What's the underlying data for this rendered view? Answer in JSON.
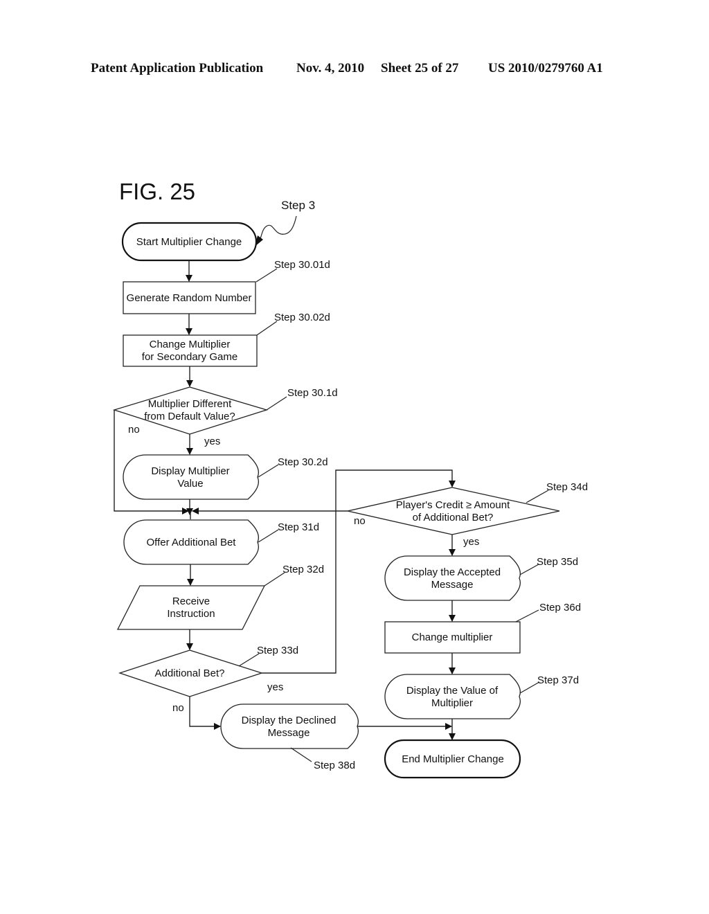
{
  "header": {
    "publication": "Patent Application Publication",
    "date": "Nov. 4, 2010",
    "sheet": "Sheet 25 of 27",
    "patent_number": "US 2010/0279760 A1"
  },
  "figure": {
    "title": "FIG. 25",
    "entry_label": "Step 3"
  },
  "nodes": {
    "start": {
      "type": "terminal",
      "lines": [
        "Start Multiplier Change"
      ]
    },
    "generate": {
      "type": "process",
      "step": "Step 30.01d",
      "lines": [
        "Generate Random Number"
      ]
    },
    "change_secondary": {
      "type": "process",
      "step": "Step 30.02d",
      "lines": [
        "Change Multiplier",
        "for Secondary Game"
      ]
    },
    "decision_default": {
      "type": "decision",
      "step": "Step 30.1d",
      "lines": [
        "Multiplier Different",
        "from Default Value?"
      ]
    },
    "display_value": {
      "type": "display",
      "step": "Step 30.2d",
      "lines": [
        "Display Multiplier",
        "Value"
      ]
    },
    "offer_bet": {
      "type": "display",
      "step": "Step 31d",
      "lines": [
        "Offer Additional Bet"
      ]
    },
    "receive": {
      "type": "input",
      "step": "Step 32d",
      "lines": [
        "Receive",
        "Instruction"
      ]
    },
    "decision_bet": {
      "type": "decision",
      "step": "Step 33d",
      "lines": [
        "Additional Bet?"
      ]
    },
    "decision_credit": {
      "type": "decision",
      "step": "Step 34d",
      "lines": [
        "Player's Credit ≥ Amount",
        "of Additional Bet?"
      ]
    },
    "display_accepted": {
      "type": "display",
      "step": "Step 35d",
      "lines": [
        "Display the Accepted",
        "Message"
      ]
    },
    "change_multiplier": {
      "type": "process",
      "step": "Step 36d",
      "lines": [
        "Change multiplier"
      ]
    },
    "display_value_of": {
      "type": "display",
      "step": "Step 37d",
      "lines": [
        "Display the Value of",
        "Multiplier"
      ]
    },
    "display_declined": {
      "type": "display",
      "step": "Step 38d",
      "lines": [
        "Display the Declined",
        "Message"
      ]
    },
    "end": {
      "type": "terminal",
      "lines": [
        "End Multiplier Change"
      ]
    }
  },
  "edge_labels": {
    "default_no": "no",
    "default_yes": "yes",
    "credit_no": "no",
    "credit_yes": "yes",
    "bet_yes": "yes",
    "bet_no": "no"
  }
}
